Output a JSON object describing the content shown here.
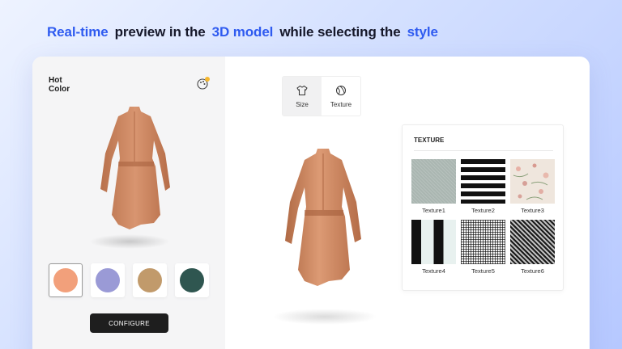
{
  "headline": {
    "part1": "Real-time",
    "part2": "preview in the",
    "part3": "3D model",
    "part4": "while selecting the",
    "part5": "style"
  },
  "left_panel": {
    "hot_label_line1": "Hot",
    "hot_label_line2": "Color",
    "badge_icon": "color-palette-icon",
    "swatches": [
      {
        "name": "peach",
        "color": "#f2a07b",
        "selected": true
      },
      {
        "name": "lavender",
        "color": "#9a9ad6",
        "selected": false
      },
      {
        "name": "tan",
        "color": "#c19a6b",
        "selected": false
      },
      {
        "name": "dark-teal",
        "color": "#2f5650",
        "selected": false
      }
    ],
    "configure_label": "CONFIGURE"
  },
  "tabs": [
    {
      "label": "Size",
      "icon": "tshirt-icon",
      "active": true
    },
    {
      "label": "Texture",
      "icon": "texture-ball-icon",
      "active": false
    }
  ],
  "texture_panel": {
    "title": "TEXTURE",
    "items": [
      {
        "label": "Texture1"
      },
      {
        "label": "Texture2"
      },
      {
        "label": "Texture3"
      },
      {
        "label": "Texture4"
      },
      {
        "label": "Texture5"
      },
      {
        "label": "Texture6"
      }
    ]
  },
  "colors": {
    "accent": "#2f5bf0",
    "dress": "#cf8a62",
    "button": "#1e1e1e"
  }
}
